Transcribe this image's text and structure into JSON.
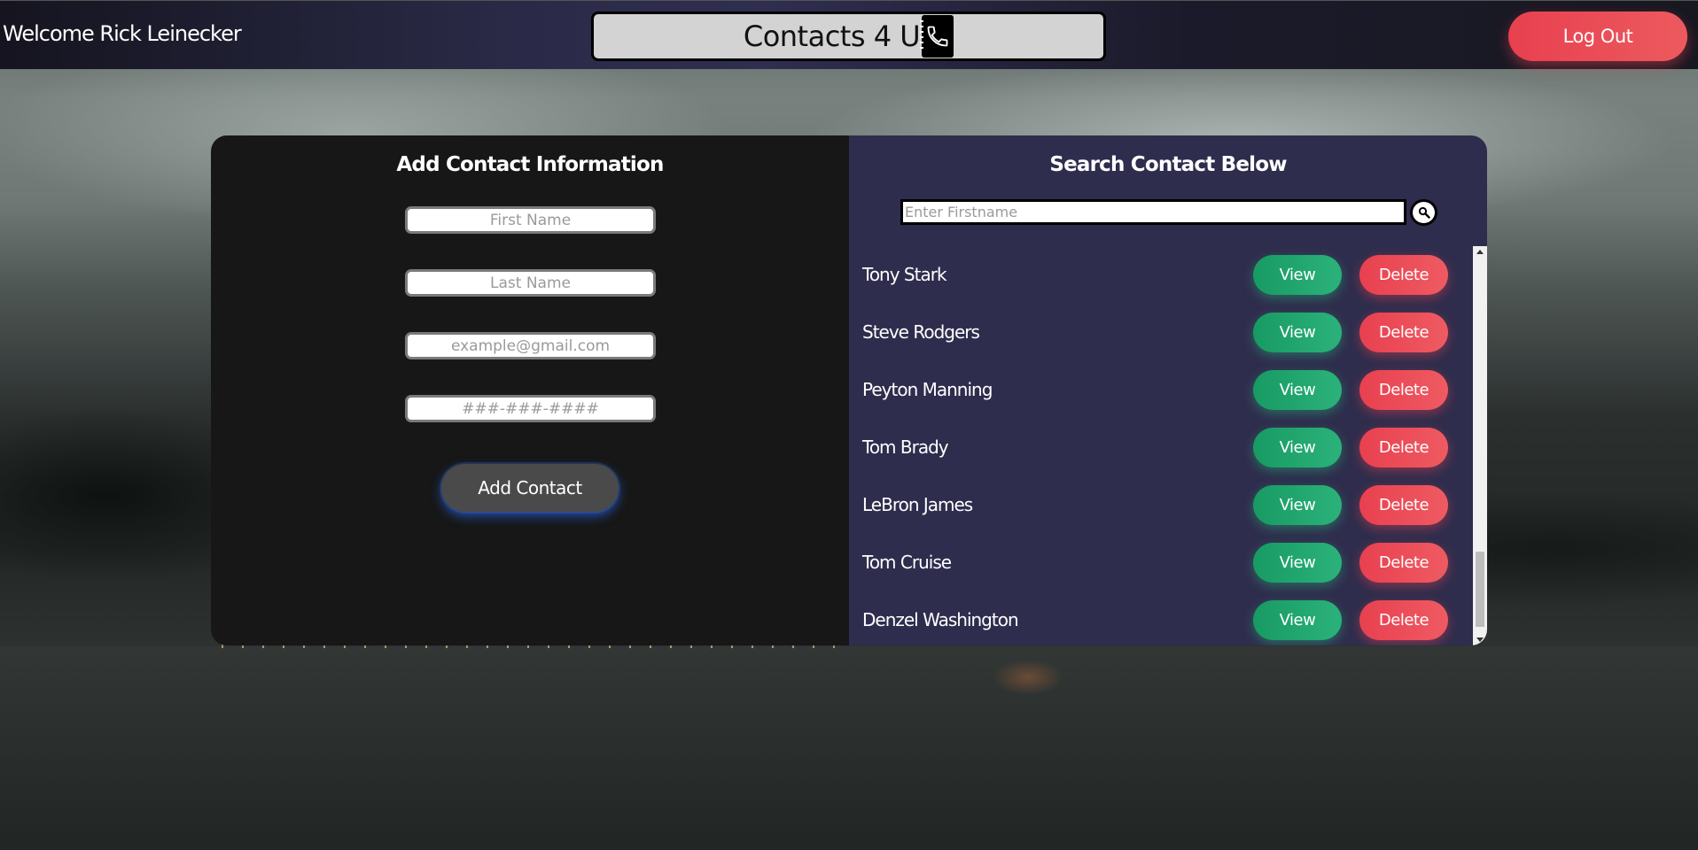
{
  "header": {
    "welcome_text": "Welcome Rick Leinecker",
    "brand_title": "Contacts 4 U",
    "logout_label": "Log Out"
  },
  "add_panel": {
    "title": "Add Contact Information",
    "first_name_placeholder": "First Name",
    "last_name_placeholder": "Last Name",
    "email_placeholder": "example@gmail.com",
    "phone_placeholder": "###-###-####",
    "add_button_label": "Add Contact"
  },
  "search_panel": {
    "title": "Search Contact Below",
    "search_placeholder": "Enter Firstname",
    "view_label": "View",
    "delete_label": "Delete",
    "contacts": [
      {
        "name": "Tony Stark"
      },
      {
        "name": "Steve Rodgers"
      },
      {
        "name": "Peyton Manning"
      },
      {
        "name": "Tom Brady"
      },
      {
        "name": "LeBron James"
      },
      {
        "name": "Tom Cruise"
      },
      {
        "name": "Denzel Washington"
      }
    ]
  },
  "icons": {
    "brand": "phone-book-icon",
    "search": "magnifier-icon"
  },
  "colors": {
    "view": "#1fa56d",
    "delete": "#e8404f",
    "search_panel_bg": "#2f2d4d",
    "add_panel_bg": "#171717"
  }
}
